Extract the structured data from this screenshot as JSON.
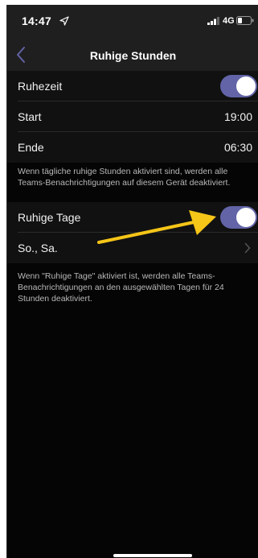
{
  "status_bar": {
    "time": "14:47",
    "network": "4G",
    "icons": [
      "location-arrow-icon",
      "signal-icon",
      "battery-icon"
    ]
  },
  "nav": {
    "title": "Ruhige Stunden",
    "back_icon": "chevron-left-icon"
  },
  "quiet_hours": {
    "toggle_label": "Ruhezeit",
    "toggle_on": true,
    "start_label": "Start",
    "start_value": "19:00",
    "end_label": "Ende",
    "end_value": "06:30",
    "note": "Wenn tägliche ruhige Stunden aktiviert sind, werden alle Teams-Benachrichtigungen auf diesem Gerät deaktiviert."
  },
  "quiet_days": {
    "toggle_label": "Ruhige Tage",
    "toggle_on": true,
    "days_label": "So., Sa.",
    "note": "Wenn \"Ruhige Tage\" aktiviert ist, werden alle Teams-Benachrichtigungen an den ausgewählten Tagen für 24 Stunden deaktiviert."
  },
  "colors": {
    "accent": "#6264a7",
    "annotation_arrow": "#f5c518",
    "background": "#050505",
    "row_background": "#111111"
  }
}
